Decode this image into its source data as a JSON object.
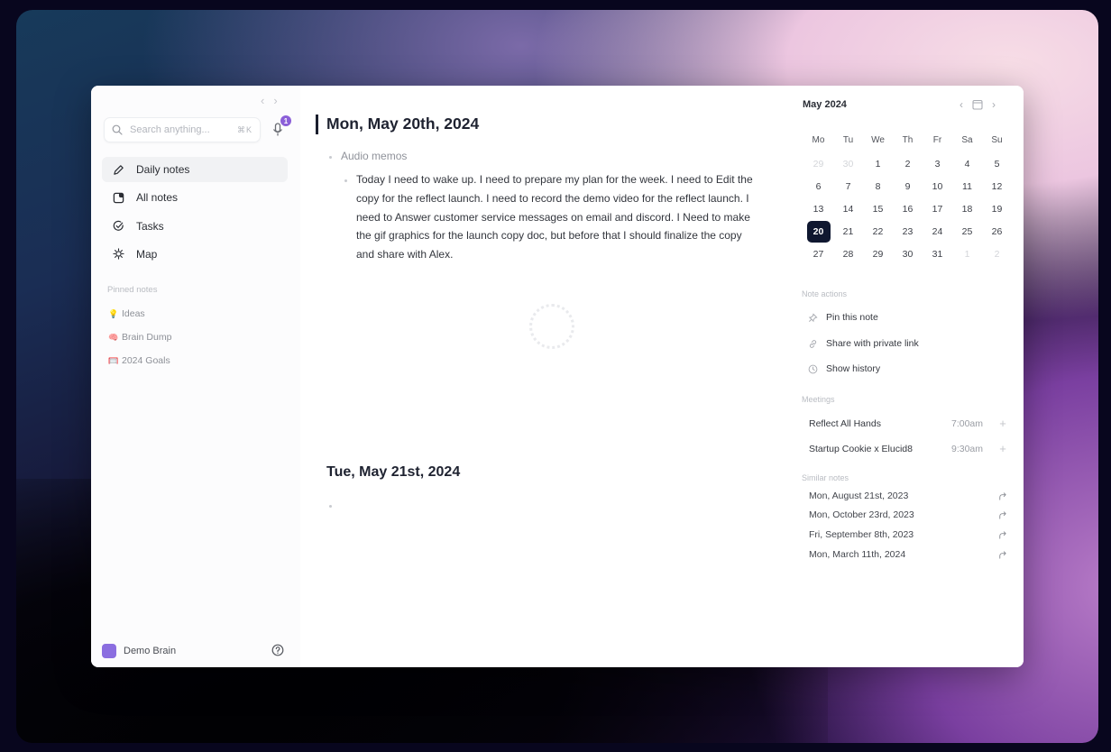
{
  "sidebar": {
    "search": {
      "placeholder": "Search anything...",
      "shortcut": "⌘K"
    },
    "mic_badge": "1",
    "nav": [
      {
        "label": "Daily notes",
        "icon": "pencil-icon",
        "active": true
      },
      {
        "label": "All notes",
        "icon": "notes-icon",
        "active": false
      },
      {
        "label": "Tasks",
        "icon": "check-circle-icon",
        "active": false
      },
      {
        "label": "Map",
        "icon": "map-icon",
        "active": false
      }
    ],
    "pinned_label": "Pinned notes",
    "pinned": [
      {
        "emoji": "💡",
        "label": "Ideas"
      },
      {
        "emoji": "🧠",
        "label": "Brain Dump"
      },
      {
        "emoji": "🥅",
        "label": "2024 Goals"
      }
    ],
    "brain": {
      "label": "Demo Brain",
      "color": "#8b6ee0"
    }
  },
  "main": {
    "day1": {
      "title": "Mon, May 20th, 2024",
      "memo_label": "Audio memos",
      "memo_text": "Today I need to wake up. I need to prepare my plan for the week. I need to Edit the copy for the reflect launch. I need to record the demo video for the reflect launch. I need to Answer customer service messages on email and discord. I Need to make the gif graphics for the launch copy doc, but before that I should finalize the copy and share with Alex."
    },
    "day2": {
      "title": "Tue, May 21st, 2024"
    }
  },
  "calendar": {
    "month": "May 2024",
    "weekdays": [
      "Mo",
      "Tu",
      "We",
      "Th",
      "Fr",
      "Sa",
      "Su"
    ],
    "weeks": [
      [
        {
          "d": "29",
          "m": true
        },
        {
          "d": "30",
          "m": true
        },
        {
          "d": "1"
        },
        {
          "d": "2"
        },
        {
          "d": "3"
        },
        {
          "d": "4"
        },
        {
          "d": "5"
        }
      ],
      [
        {
          "d": "6"
        },
        {
          "d": "7"
        },
        {
          "d": "8"
        },
        {
          "d": "9"
        },
        {
          "d": "10"
        },
        {
          "d": "11"
        },
        {
          "d": "12"
        }
      ],
      [
        {
          "d": "13"
        },
        {
          "d": "14"
        },
        {
          "d": "15"
        },
        {
          "d": "16"
        },
        {
          "d": "17"
        },
        {
          "d": "18"
        },
        {
          "d": "19"
        }
      ],
      [
        {
          "d": "20",
          "today": true
        },
        {
          "d": "21"
        },
        {
          "d": "22"
        },
        {
          "d": "23"
        },
        {
          "d": "24"
        },
        {
          "d": "25"
        },
        {
          "d": "26"
        }
      ],
      [
        {
          "d": "27"
        },
        {
          "d": "28"
        },
        {
          "d": "29"
        },
        {
          "d": "30"
        },
        {
          "d": "31"
        },
        {
          "d": "1",
          "m": true
        },
        {
          "d": "2",
          "m": true
        }
      ]
    ],
    "today_color": "#0f1730"
  },
  "note_actions": {
    "label": "Note actions",
    "items": [
      {
        "label": "Pin this note",
        "icon": "pin-icon"
      },
      {
        "label": "Share with private link",
        "icon": "link-icon"
      },
      {
        "label": "Show history",
        "icon": "clock-icon"
      }
    ]
  },
  "meetings": {
    "label": "Meetings",
    "items": [
      {
        "name": "Reflect All Hands",
        "time": "7:00am"
      },
      {
        "name": "Startup Cookie x Elucid8",
        "time": "9:30am"
      }
    ]
  },
  "similar_notes": {
    "label": "Similar notes",
    "items": [
      {
        "label": "Mon, August 21st, 2023"
      },
      {
        "label": "Mon, October 23rd, 2023"
      },
      {
        "label": "Fri, September 8th, 2023"
      },
      {
        "label": "Mon, March 11th, 2024"
      }
    ]
  }
}
